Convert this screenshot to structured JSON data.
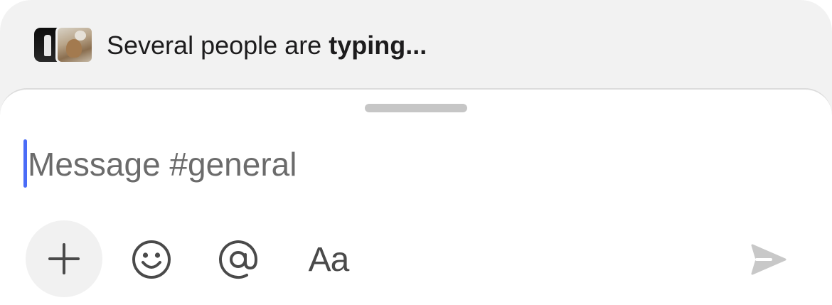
{
  "typing_indicator": {
    "prefix": "Several people are ",
    "emphasis": "typing..."
  },
  "composer": {
    "placeholder": "Message #general",
    "value": ""
  },
  "toolbar": {
    "plus_icon": "plus-icon",
    "emoji_icon": "emoji-icon",
    "mention_icon": "mention-icon",
    "format_label": "Aa",
    "send_icon": "send-icon"
  },
  "colors": {
    "accent": "#4a6cf7",
    "send_disabled": "#c8c8c8",
    "icon": "#4a4a4a"
  }
}
